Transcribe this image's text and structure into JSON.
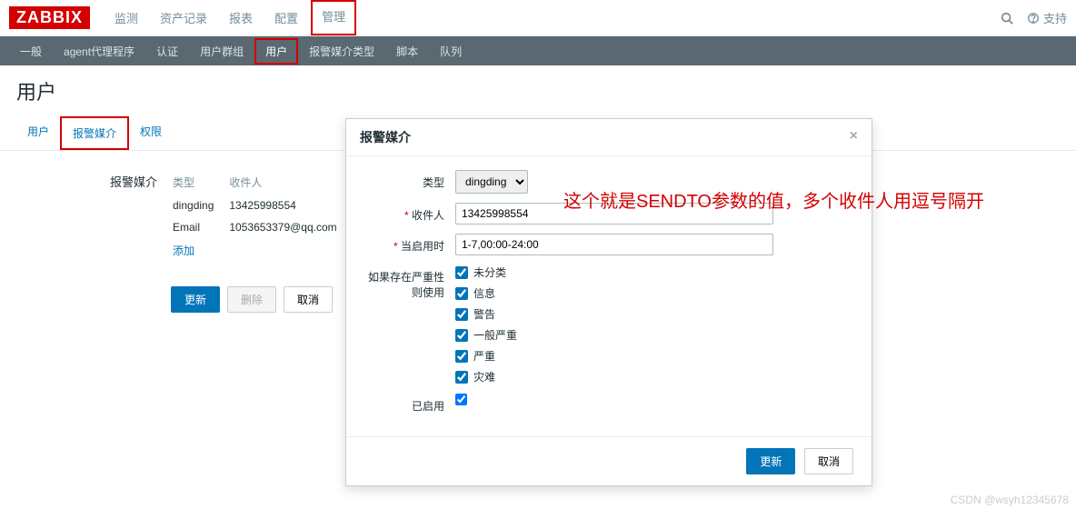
{
  "logo": "ZABBIX",
  "topNav": [
    "监测",
    "资产记录",
    "报表",
    "配置",
    "管理"
  ],
  "topRight": {
    "support": "支持"
  },
  "subNav": [
    "一般",
    "agent代理程序",
    "认证",
    "用户群组",
    "用户",
    "报警媒介类型",
    "脚本",
    "队列"
  ],
  "pageTitle": "用户",
  "tabs": [
    "用户",
    "报警媒介",
    "权限"
  ],
  "mediaSection": {
    "label": "报警媒介",
    "cols": [
      "类型",
      "收件人"
    ],
    "rows": [
      {
        "type": "dingding",
        "recipient": "13425998554"
      },
      {
        "type": "Email",
        "recipient": "1053653379@qq.com"
      }
    ],
    "addLink": "添加"
  },
  "buttons": {
    "update": "更新",
    "delete": "删除",
    "cancel": "取消"
  },
  "modal": {
    "title": "报警媒介",
    "typeLabel": "类型",
    "typeValue": "dingding",
    "recipientLabel": "收件人",
    "recipientValue": "13425998554",
    "enabledTimeLabel": "当启用时",
    "enabledTimeValue": "1-7,00:00-24:00",
    "severityLabel": "如果存在严重性则使用",
    "severities": [
      "未分类",
      "信息",
      "警告",
      "一般严重",
      "严重",
      "灾难"
    ],
    "enabledLabel": "已启用",
    "updateBtn": "更新",
    "cancelBtn": "取消"
  },
  "annotation": "这个就是SENDTO参数的值，多个收件人用逗号隔开",
  "watermark": "CSDN @wsyh12345678"
}
